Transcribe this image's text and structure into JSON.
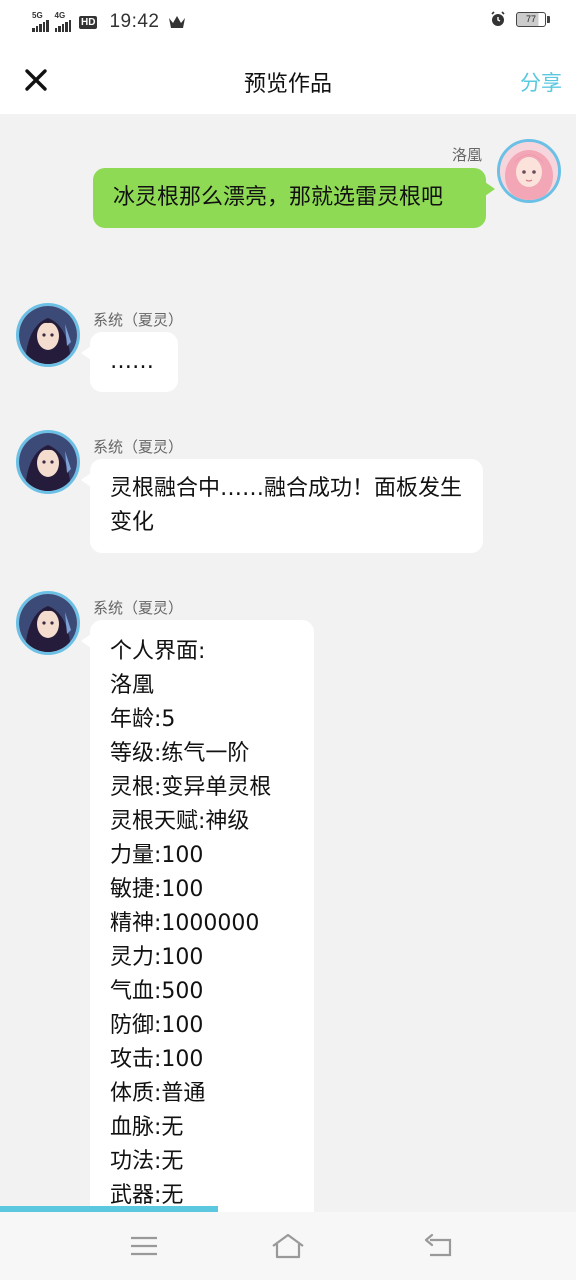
{
  "status_bar": {
    "net1": "5G",
    "net2": "4G",
    "hd": "HD",
    "time": "19:42",
    "battery": "77",
    "icons": [
      "signal-5g-icon",
      "signal-4g-icon",
      "hd-voice-icon",
      "crown-icon",
      "alarm-icon",
      "battery-icon"
    ]
  },
  "header": {
    "title": "预览作品",
    "share_label": "分享",
    "close_icon": "close-icon"
  },
  "colors": {
    "accent": "#5bc8e0",
    "my_bubble": "#8fda54",
    "their_bubble": "#ffffff",
    "background": "#f2f2f2"
  },
  "messages": [
    {
      "side": "right",
      "sender": "洛凰",
      "text": "冰灵根那么漂亮，那就选雷灵根吧",
      "avatar": "pink-hair-girl-avatar"
    },
    {
      "side": "left",
      "sender": "系统（夏灵）",
      "text": "……",
      "avatar": "system-xialing-avatar"
    },
    {
      "side": "left",
      "sender": "系统（夏灵）",
      "text": "灵根融合中……融合成功！面板发生变化",
      "avatar": "system-xialing-avatar"
    },
    {
      "side": "left",
      "sender": "系统（夏灵）",
      "avatar": "system-xialing-avatar",
      "lines": [
        "个人界面:",
        "洛凰",
        "年龄:5",
        "等级:练气一阶",
        "灵根:变异单灵根",
        "灵根天赋:神级",
        "力量:100",
        "敏捷:100",
        "精神:1000000",
        "灵力:100",
        "气血:500",
        "防御:100",
        "攻击:100",
        "体质:普通",
        "血脉:无",
        "功法:无",
        "武器:无"
      ]
    }
  ],
  "nav_bar": {
    "icons": [
      "menu-icon",
      "home-icon",
      "back-icon"
    ]
  }
}
